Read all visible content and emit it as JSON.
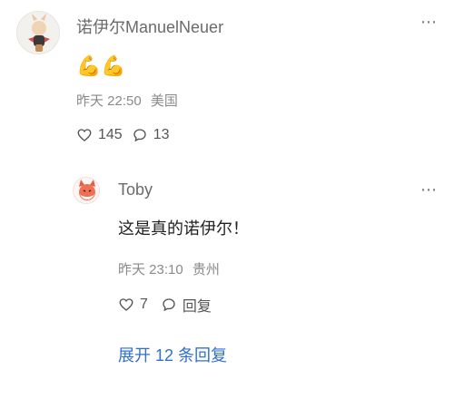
{
  "main_comment": {
    "username": "诺伊尔ManuelNeuer",
    "content_emoji": "💪💪",
    "time": "昨天 22:50",
    "location": "美国",
    "likes": "145",
    "comments": "13",
    "more_glyph": "⋯"
  },
  "reply": {
    "username": "Toby",
    "content": "这是真的诺伊尔！",
    "time": "昨天 23:10",
    "location": "贵州",
    "likes": "7",
    "reply_label": "回复",
    "more_glyph": "⋯"
  },
  "expand_label": "展开 12 条回复",
  "icons": {
    "main_avatar": "avatar-bunny-icon",
    "reply_avatar": "avatar-fox-icon",
    "like": "heart-icon",
    "comment": "comment-bubble-icon"
  },
  "colors": {
    "link": "#2f6fd6",
    "muted": "#8a8a8a",
    "text": "#222222"
  }
}
